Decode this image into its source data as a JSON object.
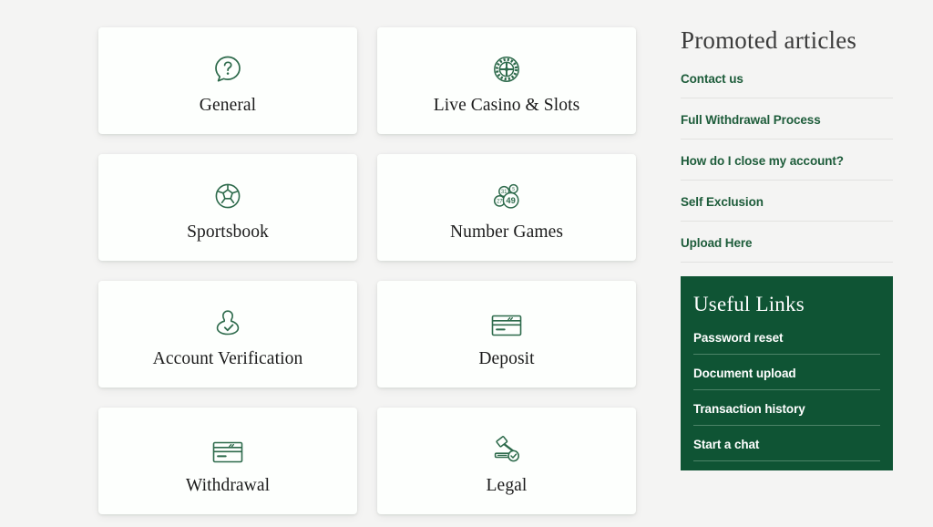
{
  "theme": {
    "page_background": "#f4f4f3",
    "card_background": "#fdfffd",
    "icon_green": "#2d6a4b",
    "brand_green": "#0f5434",
    "link_green": "#1d5c3a",
    "panel_divider": "#4d8468",
    "label_text": "#1b1b1b"
  },
  "categories": [
    {
      "label": "General",
      "icon": "question-speech-bubble-icon"
    },
    {
      "label": "Live Casino & Slots",
      "icon": "casino-chip-icon"
    },
    {
      "label": "Sportsbook",
      "icon": "soccer-ball-icon"
    },
    {
      "label": "Number Games",
      "icon": "lottery-balls-icon",
      "ball_numbers": [
        "5",
        "31",
        "27",
        "49"
      ]
    },
    {
      "label": "Account Verification",
      "icon": "user-check-icon"
    },
    {
      "label": "Deposit",
      "icon": "credit-card-icon"
    },
    {
      "label": "Withdrawal",
      "icon": "credit-card-icon"
    },
    {
      "label": "Legal",
      "icon": "gavel-check-icon"
    }
  ],
  "sidebar": {
    "title": "Promoted articles",
    "articles": [
      {
        "label": "Contact us"
      },
      {
        "label": "Full Withdrawal Process"
      },
      {
        "label": "How do I close my account?"
      },
      {
        "label": "Self Exclusion"
      },
      {
        "label": "Upload Here"
      }
    ]
  },
  "useful_links": {
    "title": "Useful Links",
    "links": [
      {
        "label": "Password reset"
      },
      {
        "label": "Document upload"
      },
      {
        "label": "Transaction history"
      },
      {
        "label": "Start a chat"
      }
    ]
  }
}
